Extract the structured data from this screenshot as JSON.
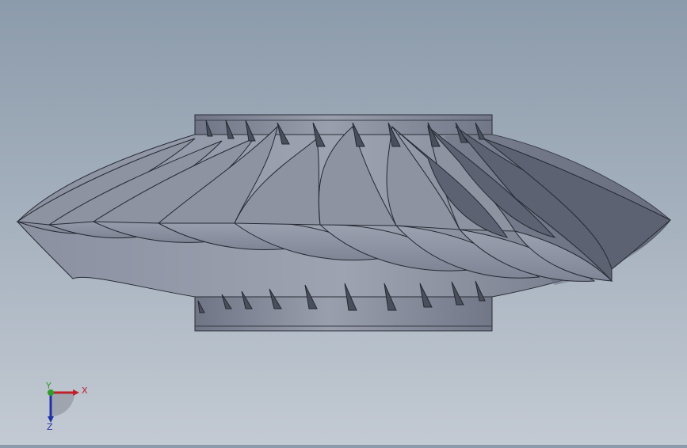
{
  "viewport": {
    "background_top": "#8c9bab",
    "background_bottom": "#c3cad3",
    "model": {
      "name": "",
      "body_color": "#7e8494",
      "hub_color": "#8a8f9f",
      "blade_count": 15
    }
  },
  "triad": {
    "x_label": "X",
    "y_label": "Y",
    "z_label": "Z",
    "x_color": "#c0202a",
    "y_color": "#2aa02a",
    "z_color": "#2030a8"
  }
}
